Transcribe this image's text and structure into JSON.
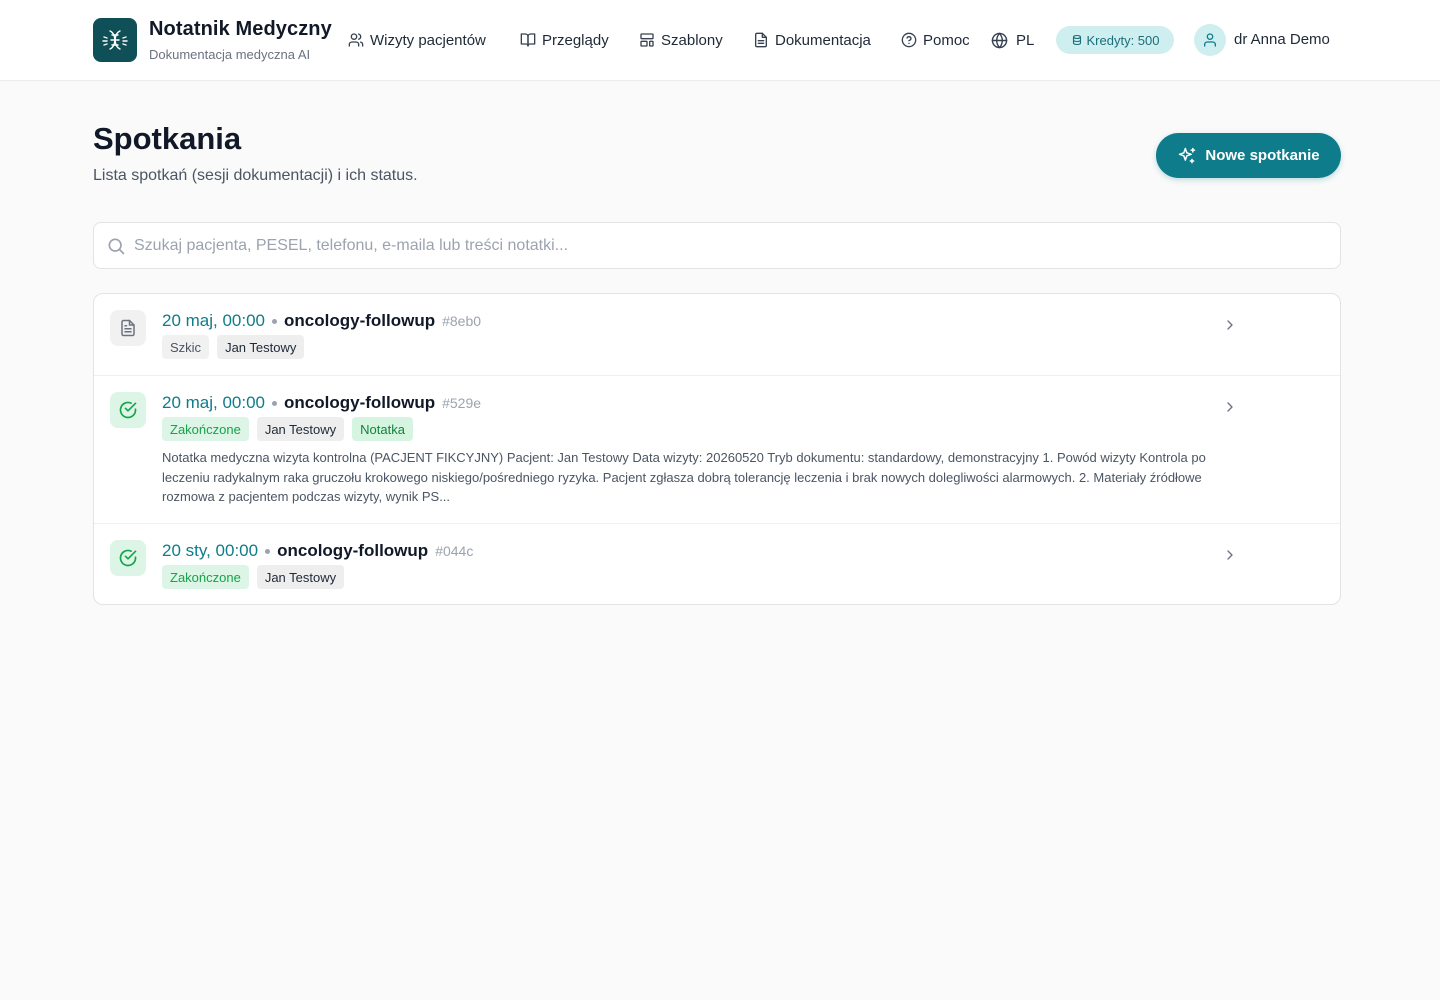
{
  "header": {
    "brand_title": "Notatnik Medyczny",
    "brand_subtitle": "Dokumentacja medyczna AI",
    "nav": [
      {
        "label": "Wizyty pacjentów",
        "icon": "users-icon"
      },
      {
        "label": "Przeglądy",
        "icon": "book-open-icon"
      },
      {
        "label": "Szablony",
        "icon": "layout-template-icon"
      },
      {
        "label": "Dokumentacja",
        "icon": "file-text-icon"
      },
      {
        "label": "Pomoc",
        "icon": "help-circle-icon"
      },
      {
        "label": "PL",
        "icon": "globe-icon"
      }
    ],
    "credits_label": "Kredyty: 500",
    "user_name": "dr Anna Demo"
  },
  "page": {
    "title": "Spotkania",
    "subtitle": "Lista spotkań (sesji dokumentacji) i ich status.",
    "new_button_label": "Nowe spotkanie"
  },
  "search": {
    "placeholder": "Szukaj pacjenta, PESEL, telefonu, e-maila lub treści notatki...",
    "value": ""
  },
  "encounters": [
    {
      "date": "20 maj, 00:00",
      "type": "oncology-followup",
      "id": "#8eb0",
      "status_icon": "file-text-icon",
      "status": "Szkic",
      "patient": "Jan Testowy"
    },
    {
      "date": "20 maj, 00:00",
      "type": "oncology-followup",
      "id": "#529e",
      "status_icon": "check-circle-icon",
      "status": "Zakończone",
      "patient": "Jan Testowy",
      "extra_tag": "Notatka",
      "snippet": "Notatka medyczna wizyta kontrolna (PACJENT FIKCYJNY) Pacjent: Jan Testowy Data wizyty: 20260520 Tryb dokumentu: standardowy, demonstracyjny 1. Powód wizyty Kontrola po leczeniu radykalnym raka gruczołu krokowego niskiego/pośredniego ryzyka. Pacjent zgłasza dobrą tolerancję leczenia i brak nowych dolegliwości alarmowych. 2. Materiały źródłowe rozmowa z pacjentem podczas wizyty, wynik PS..."
    },
    {
      "date": "20 sty, 00:00",
      "type": "oncology-followup",
      "id": "#044c",
      "status_icon": "check-circle-icon",
      "status": "Zakończone",
      "patient": "Jan Testowy"
    }
  ],
  "colors": {
    "accent": "#0e7c8a",
    "brand_dark": "#0f4f57",
    "success": "#16a34a",
    "page_bg": "#fafafa"
  }
}
